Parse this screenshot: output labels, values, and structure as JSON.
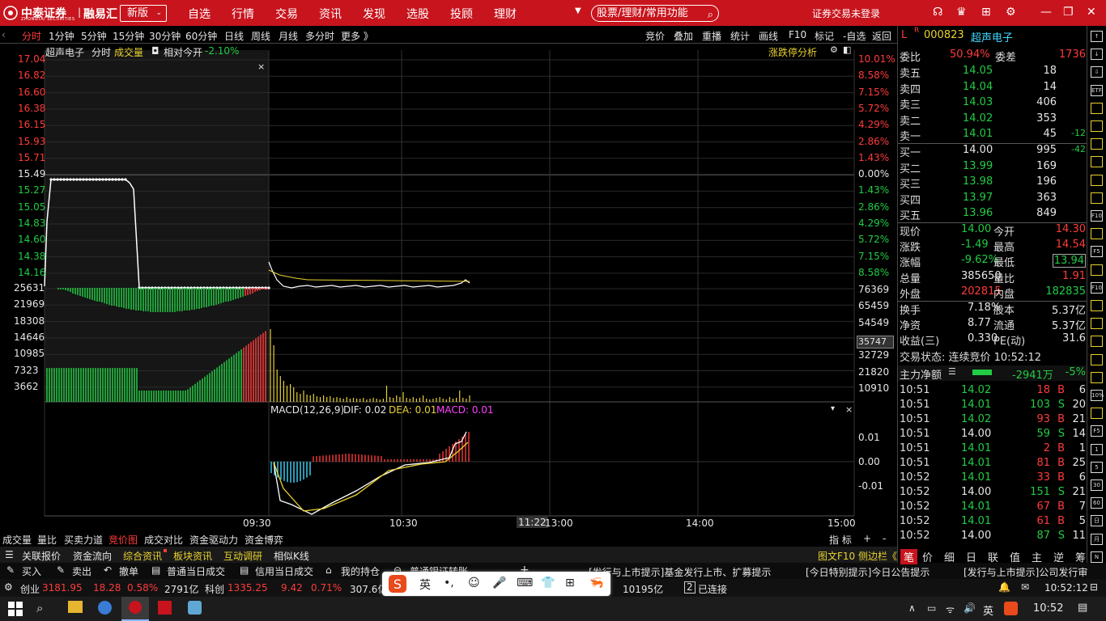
{
  "titlebar": {
    "brand": "中泰证券",
    "brand_sub": "ZHONGTAI SECURITIES",
    "app": "融易汇",
    "version": "新版",
    "nav": [
      "自选",
      "行情",
      "交易",
      "资讯",
      "发现",
      "选股",
      "投顾",
      "理财"
    ],
    "search_placeholder": "股票/理财/常用功能",
    "login": "证券交易未登录"
  },
  "periods": [
    "分时",
    "1分钟",
    "5分钟",
    "15分钟",
    "30分钟",
    "60分钟",
    "日线",
    "周线",
    "月线",
    "多分时",
    "更多 》"
  ],
  "tools": [
    "竞价",
    "叠加",
    "重播",
    "统计",
    "画线",
    "F10",
    "标记",
    "-自选",
    "返回"
  ],
  "chart_header": {
    "name": "超声电子",
    "mode": "分时",
    "vol": "成交量",
    "rel": "相对今开",
    "rel_val": "-2.10%",
    "analysis": "涨跌停分析"
  },
  "y_left": [
    "17.04",
    "16.82",
    "16.60",
    "16.38",
    "16.15",
    "15.93",
    "15.71",
    "15.49",
    "15.27",
    "15.05",
    "14.83",
    "14.60",
    "14.38",
    "14.16"
  ],
  "y_right": [
    "10.01%",
    "8.58%",
    "7.15%",
    "5.72%",
    "4.29%",
    "2.86%",
    "1.43%",
    "0.00%",
    "1.43%",
    "2.86%",
    "4.29%",
    "5.72%",
    "7.15%",
    "8.58%"
  ],
  "vol_left": [
    "25631",
    "21969",
    "18308",
    "14646",
    "10985",
    "7323",
    "3662"
  ],
  "vol_right": [
    "76369",
    "65459",
    "54549",
    "43639",
    "32729",
    "21820",
    "10910"
  ],
  "vol_cursor": "35747",
  "macd": {
    "label": "MACD(12,26,9)",
    "dif": "DIF: 0.02",
    "dea": "DEA: 0.01",
    "macd": "MACD: 0.01",
    "ticks": [
      "0.01",
      "0.00",
      "-0.01"
    ]
  },
  "x_labels": [
    "09:30",
    "10:30",
    "11:22",
    "13:00",
    "14:00",
    "15:00"
  ],
  "stock": {
    "code": "000823",
    "name": "超声电子",
    "weibi_label": "委比",
    "weibi": "50.94%",
    "weicha_label": "委差",
    "weicha": "1736"
  },
  "asks": [
    [
      "卖五",
      "14.05",
      "18",
      ""
    ],
    [
      "卖四",
      "14.04",
      "14",
      ""
    ],
    [
      "卖三",
      "14.03",
      "406",
      ""
    ],
    [
      "卖二",
      "14.02",
      "353",
      ""
    ],
    [
      "卖一",
      "14.01",
      "45",
      "-12"
    ]
  ],
  "bids": [
    [
      "买一",
      "14.00",
      "995",
      "-42"
    ],
    [
      "买二",
      "13.99",
      "169",
      ""
    ],
    [
      "买三",
      "13.98",
      "196",
      ""
    ],
    [
      "买四",
      "13.97",
      "363",
      ""
    ],
    [
      "买五",
      "13.96",
      "849",
      ""
    ]
  ],
  "quote": [
    [
      "现价",
      "14.00",
      "今开",
      "14.30"
    ],
    [
      "涨跌",
      "-1.49",
      "最高",
      "14.54"
    ],
    [
      "涨幅",
      "-9.62%",
      "最低",
      "13.94"
    ],
    [
      "总量",
      "385650",
      "量比",
      "1.91"
    ],
    [
      "外盘",
      "202815",
      "内盘",
      "182835"
    ]
  ],
  "quote2": [
    [
      "换手",
      "7.18%",
      "股本",
      "5.37亿"
    ],
    [
      "净资",
      "8.77",
      "流通",
      "5.37亿"
    ],
    [
      "收益(三)",
      "0.330",
      "PE(动)",
      "31.6"
    ]
  ],
  "trade_status": "交易状态: 连续竞价 10:52:12",
  "capital": {
    "label": "主力净额",
    "value": "-2941万",
    "pct": "-5%"
  },
  "ticks": [
    [
      "10:51",
      "14.02",
      "18",
      "B",
      "6"
    ],
    [
      "10:51",
      "14.01",
      "103",
      "S",
      "20"
    ],
    [
      "10:51",
      "14.02",
      "93",
      "B",
      "21"
    ],
    [
      "10:51",
      "14.00",
      "59",
      "S",
      "14"
    ],
    [
      "10:51",
      "14.01",
      "2",
      "B",
      "1"
    ],
    [
      "10:51",
      "14.01",
      "81",
      "B",
      "25"
    ],
    [
      "10:52",
      "14.01",
      "33",
      "B",
      "6"
    ],
    [
      "10:52",
      "14.00",
      "151",
      "S",
      "21"
    ],
    [
      "10:52",
      "14.01",
      "67",
      "B",
      "7"
    ],
    [
      "10:52",
      "14.01",
      "61",
      "B",
      "5"
    ],
    [
      "10:52",
      "14.00",
      "87",
      "S",
      "11"
    ]
  ],
  "bottom1": [
    "成交量",
    "量比",
    "买卖力道",
    "竞价图",
    "成交对比",
    "资金驱动力",
    "资金博弈"
  ],
  "bottom1_right": [
    "指 标",
    "+",
    "-"
  ],
  "bottom2": [
    "关联报价",
    "资金流向",
    "综合资讯",
    "板块资讯",
    "互动调研",
    "相似K线"
  ],
  "bottom2_right": "图文F10 侧边栏《",
  "bottom2_tabs": [
    "笔",
    "价",
    "细",
    "日",
    "联",
    "值",
    "主",
    "逆",
    "筹"
  ],
  "bottom3": [
    "买入",
    "卖出",
    "撤单",
    "普通当日成交",
    "信用当日成交",
    "我的持仓",
    "普通银证转账"
  ],
  "news1": "[发行与上市提示]基金发行上市、扩募提示",
  "news2": "[今日特别提示]今日公告提示",
  "news3": "[发行与上市提示]公司发行审",
  "status": {
    "idx1": "创业",
    "idx1_val": "3181.95",
    "idx1_chg": "18.28",
    "idx1_pct": "0.58%",
    "idx1_amt": "2791亿",
    "idx2": "科创",
    "idx2_val": "1335.25",
    "idx2_chg": "9.42",
    "idx2_pct": "0.71%",
    "idx2_amt": "307.6亿",
    "amt3": "10195亿",
    "conn_num": "2",
    "conn": "已连接",
    "time": "10:52:12"
  },
  "sidebar": [
    "↑",
    "↓",
    "⇩",
    "ETF",
    "",
    "",
    "",
    "",
    "",
    "",
    "F10",
    "",
    "F5",
    "",
    "F10",
    "",
    "",
    "",
    "",
    "",
    "10%",
    "",
    "F5",
    "1",
    "5",
    "30",
    "60",
    "日",
    "月",
    "N"
  ],
  "taskbar": {
    "time": "10:52",
    "lang": "英"
  },
  "ime": [
    "英",
    "•,",
    "☺",
    "🎤",
    "⌨",
    "👕",
    "⊞",
    "🦐"
  ],
  "colors": {
    "title_red": "#c8141d",
    "up": "#ff3b3b",
    "down": "#22cc44",
    "yellow": "#e8d230"
  }
}
